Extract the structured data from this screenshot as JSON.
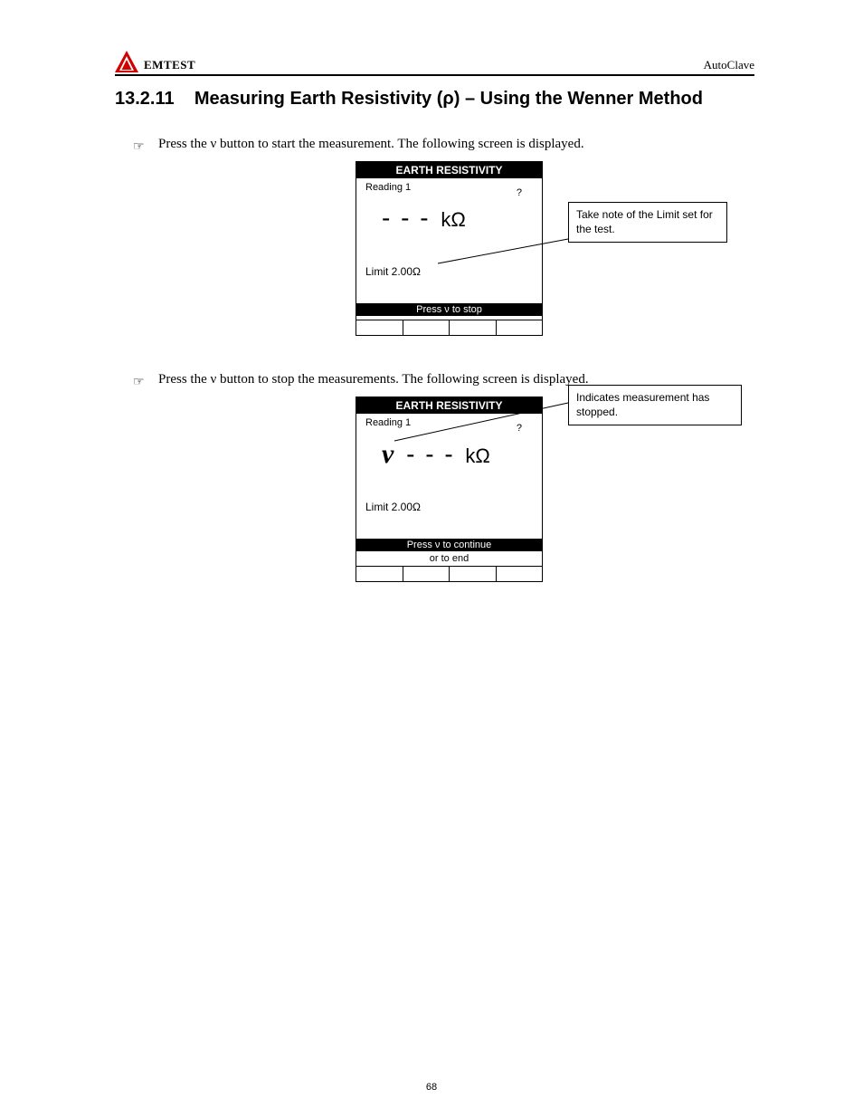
{
  "header": {
    "brand": "EMTEST",
    "right": "AutoClave"
  },
  "section": {
    "number": "13.2.11",
    "title": "Measuring Earth Resistivity (ρ) – Using the Wenner Method"
  },
  "step1": {
    "text": "Press the ν button to start the measurement. The following screen is displayed.",
    "screen": {
      "title": "EARTH RESISTIVITY",
      "reading_label": "Reading 1",
      "big_dashes": "- - -",
      "big_unit_prefix": "k",
      "big_unit": "Ω",
      "big_k": "k",
      "mark": "?",
      "limit": "Limit     2.00Ω",
      "bottom_bar": "Press ν to stop",
      "end_text": ""
    },
    "callout": "Take note of the Limit set for the test."
  },
  "step2": {
    "text": "Press the ν button to stop the measurements. The following screen is displayed.",
    "screen": {
      "title": "EARTH RESISTIVITY",
      "reading_label": "Reading 1",
      "nu": "ν",
      "big_dashes": "- - -",
      "big_unit_prefix": "k",
      "big_unit": "Ω",
      "mark": "?",
      "limit": "Limit     2.00Ω",
      "bottom_bar": "Press ν to continue",
      "end_text": "or     to end"
    },
    "callout": "Indicates measurement has stopped."
  },
  "page_number": "68"
}
